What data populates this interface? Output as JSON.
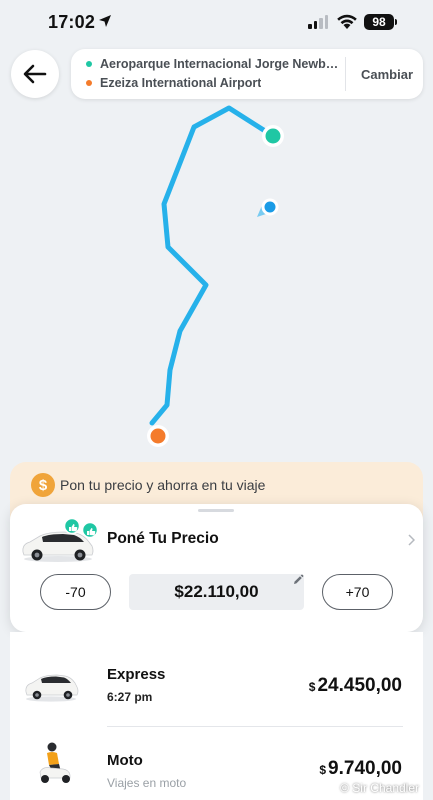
{
  "status_bar": {
    "time": "17:02",
    "battery": "98"
  },
  "route": {
    "origin": "Aeroparque Internacional Jorge Newbery",
    "destination": "Ezeiza International Airport",
    "change_label": "Cambiar",
    "origin_color": "#1fc7a4",
    "destination_color": "#f47b2b",
    "route_color": "#26b1ea"
  },
  "promo": {
    "icon": "dollar-coin-icon",
    "text": "Pon tu precio y ahorra en tu viaje"
  },
  "bid": {
    "title": "Poné Tu Precio",
    "minus_label": "-70",
    "plus_label": "+70",
    "price": "$22.110,00"
  },
  "options": [
    {
      "name": "Express",
      "eta": "6:27 pm",
      "currency": "$",
      "price": "24.450,00"
    },
    {
      "name": "Moto",
      "eta": "Viajes en moto",
      "currency": "$",
      "price": "9.740,00"
    }
  ],
  "watermark": "© Sir Chandler"
}
